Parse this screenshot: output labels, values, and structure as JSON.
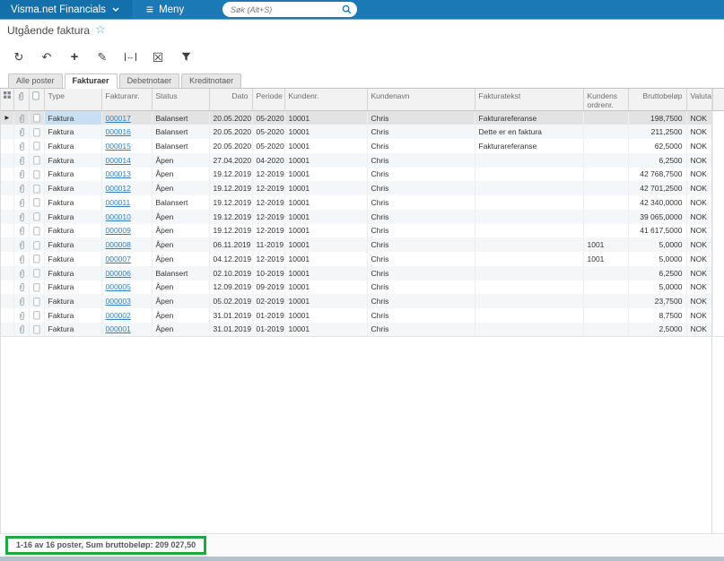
{
  "topbar": {
    "brand": "Visma.net Financials",
    "menu_label": "Meny",
    "search_placeholder": "Søk (Alt+S)"
  },
  "page": {
    "title": "Utgående faktura"
  },
  "toolbar": {
    "refresh": "↻",
    "undo": "↶",
    "add": "+",
    "edit": "✎",
    "export_excel": "☒"
  },
  "tabs": [
    {
      "label": "Alle poster",
      "active": false
    },
    {
      "label": "Fakturaer",
      "active": true
    },
    {
      "label": "Debetnotaer",
      "active": false
    },
    {
      "label": "Kreditnotaer",
      "active": false
    }
  ],
  "grid": {
    "columns": [
      "Type",
      "Fakturanr.",
      "Status",
      "Dato",
      "Periode",
      "Kundenr.",
      "Kundenavn",
      "Fakturatekst",
      "Kundens ordrenr.",
      "Bruttobeløp",
      "Valuta"
    ],
    "rows": [
      {
        "type": "Faktura",
        "fakturanr": "000017",
        "status": "Balansert",
        "dato": "20.05.2020",
        "periode": "05-2020",
        "kundenr": "10001",
        "kundenavn": "Chris",
        "fakturatekst": "Fakturareferanse",
        "kundens_ordrenr": "",
        "bruttobelop": "198,7500",
        "valuta": "NOK",
        "selected": true
      },
      {
        "type": "Faktura",
        "fakturanr": "000016",
        "status": "Balansert",
        "dato": "20.05.2020",
        "periode": "05-2020",
        "kundenr": "10001",
        "kundenavn": "Chris",
        "fakturatekst": "Dette er en faktura",
        "kundens_ordrenr": "",
        "bruttobelop": "211,2500",
        "valuta": "NOK",
        "selected": false
      },
      {
        "type": "Faktura",
        "fakturanr": "000015",
        "status": "Balansert",
        "dato": "20.05.2020",
        "periode": "05-2020",
        "kundenr": "10001",
        "kundenavn": "Chris",
        "fakturatekst": "Fakturareferanse",
        "kundens_ordrenr": "",
        "bruttobelop": "62,5000",
        "valuta": "NOK",
        "selected": false
      },
      {
        "type": "Faktura",
        "fakturanr": "000014",
        "status": "Åpen",
        "dato": "27.04.2020",
        "periode": "04-2020",
        "kundenr": "10001",
        "kundenavn": "Chris",
        "fakturatekst": "",
        "kundens_ordrenr": "",
        "bruttobelop": "6,2500",
        "valuta": "NOK",
        "selected": false
      },
      {
        "type": "Faktura",
        "fakturanr": "000013",
        "status": "Åpen",
        "dato": "19.12.2019",
        "periode": "12-2019",
        "kundenr": "10001",
        "kundenavn": "Chris",
        "fakturatekst": "",
        "kundens_ordrenr": "",
        "bruttobelop": "42 768,7500",
        "valuta": "NOK",
        "selected": false
      },
      {
        "type": "Faktura",
        "fakturanr": "000012",
        "status": "Åpen",
        "dato": "19.12.2019",
        "periode": "12-2019",
        "kundenr": "10001",
        "kundenavn": "Chris",
        "fakturatekst": "",
        "kundens_ordrenr": "",
        "bruttobelop": "42 701,2500",
        "valuta": "NOK",
        "selected": false
      },
      {
        "type": "Faktura",
        "fakturanr": "000011",
        "status": "Balansert",
        "dato": "19.12.2019",
        "periode": "12-2019",
        "kundenr": "10001",
        "kundenavn": "Chris",
        "fakturatekst": "",
        "kundens_ordrenr": "",
        "bruttobelop": "42 340,0000",
        "valuta": "NOK",
        "selected": false
      },
      {
        "type": "Faktura",
        "fakturanr": "000010",
        "status": "Åpen",
        "dato": "19.12.2019",
        "periode": "12-2019",
        "kundenr": "10001",
        "kundenavn": "Chris",
        "fakturatekst": "",
        "kundens_ordrenr": "",
        "bruttobelop": "39 065,0000",
        "valuta": "NOK",
        "selected": false
      },
      {
        "type": "Faktura",
        "fakturanr": "000009",
        "status": "Åpen",
        "dato": "19.12.2019",
        "periode": "12-2019",
        "kundenr": "10001",
        "kundenavn": "Chris",
        "fakturatekst": "",
        "kundens_ordrenr": "",
        "bruttobelop": "41 617,5000",
        "valuta": "NOK",
        "selected": false
      },
      {
        "type": "Faktura",
        "fakturanr": "000008",
        "status": "Åpen",
        "dato": "06.11.2019",
        "periode": "11-2019",
        "kundenr": "10001",
        "kundenavn": "Chris",
        "fakturatekst": "",
        "kundens_ordrenr": "1001",
        "bruttobelop": "5,0000",
        "valuta": "NOK",
        "selected": false
      },
      {
        "type": "Faktura",
        "fakturanr": "000007",
        "status": "Åpen",
        "dato": "04.12.2019",
        "periode": "12-2019",
        "kundenr": "10001",
        "kundenavn": "Chris",
        "fakturatekst": "",
        "kundens_ordrenr": "1001",
        "bruttobelop": "5,0000",
        "valuta": "NOK",
        "selected": false
      },
      {
        "type": "Faktura",
        "fakturanr": "000006",
        "status": "Balansert",
        "dato": "02.10.2019",
        "periode": "10-2019",
        "kundenr": "10001",
        "kundenavn": "Chris",
        "fakturatekst": "",
        "kundens_ordrenr": "",
        "bruttobelop": "6,2500",
        "valuta": "NOK",
        "selected": false
      },
      {
        "type": "Faktura",
        "fakturanr": "000005",
        "status": "Åpen",
        "dato": "12.09.2019",
        "periode": "09-2019",
        "kundenr": "10001",
        "kundenavn": "Chris",
        "fakturatekst": "",
        "kundens_ordrenr": "",
        "bruttobelop": "5,0000",
        "valuta": "NOK",
        "selected": false
      },
      {
        "type": "Faktura",
        "fakturanr": "000003",
        "status": "Åpen",
        "dato": "05.02.2019",
        "periode": "02-2019",
        "kundenr": "10001",
        "kundenavn": "Chris",
        "fakturatekst": "",
        "kundens_ordrenr": "",
        "bruttobelop": "23,7500",
        "valuta": "NOK",
        "selected": false
      },
      {
        "type": "Faktura",
        "fakturanr": "000002",
        "status": "Åpen",
        "dato": "31.01.2019",
        "periode": "01-2019",
        "kundenr": "10001",
        "kundenavn": "Chris",
        "fakturatekst": "",
        "kundens_ordrenr": "",
        "bruttobelop": "8,7500",
        "valuta": "NOK",
        "selected": false
      },
      {
        "type": "Faktura",
        "fakturanr": "000001",
        "status": "Åpen",
        "dato": "31.01.2019",
        "periode": "01-2019",
        "kundenr": "10001",
        "kundenavn": "Chris",
        "fakturatekst": "",
        "kundens_ordrenr": "",
        "bruttobelop": "2,5000",
        "valuta": "NOK",
        "selected": false
      }
    ]
  },
  "footer": {
    "summary": "1-16 av 16 poster, Sum bruttobeløp: 209 027,50"
  },
  "colors": {
    "topbar_blue": "#1b79b6",
    "brand_blue": "#1470ab",
    "link_blue": "#3081c4",
    "selected_cell_blue": "#c8dff1",
    "annotation_green": "#23a73c"
  }
}
